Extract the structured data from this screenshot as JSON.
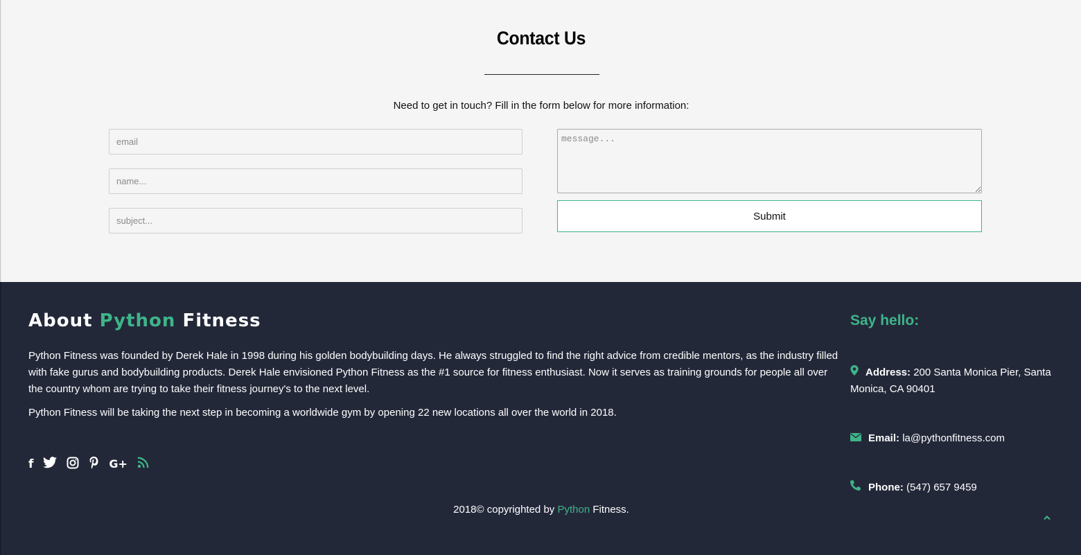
{
  "contact": {
    "title": "Contact Us",
    "intro": "Need to get in touch? Fill in the form below for more information:",
    "email_placeholder": "email",
    "name_placeholder": "name...",
    "subject_placeholder": "subject...",
    "message_placeholder": "message...",
    "submit_label": "Submit"
  },
  "footer": {
    "about_title": {
      "part1": "About ",
      "part2": "Python",
      "part3": " Fitness"
    },
    "about_paragraph_1": "Python Fitness was founded by Derek Hale in 1998 during his golden bodybuilding days. He always struggled to find the right advice from credible mentors, as the industry filled with fake gurus and bodybuilding products. Derek Hale envisioned Python Fitness as the #1 source for fitness enthusiast. Now it serves as training grounds for people all over the country whom are trying to take their fitness journey's to the next level.",
    "about_paragraph_2": "Python Fitness will be taking the next step in becoming a worldwide gym by opening 22 new locations all over the world in 2018.",
    "socials": [
      {
        "name": "facebook-icon",
        "glyph": "f"
      },
      {
        "name": "twitter-icon",
        "glyph": "🐦"
      },
      {
        "name": "instagram-icon",
        "glyph": "◎"
      },
      {
        "name": "pinterest-icon",
        "glyph": "℗"
      },
      {
        "name": "google-plus-icon",
        "glyph": "G+"
      },
      {
        "name": "rss-icon",
        "glyph": "⌇"
      }
    ],
    "say_hello": "Say hello:",
    "address_label": "Address:",
    "address_value": "200 Santa Monica Pier, Santa Monica, CA 90401",
    "email_label": "Email:",
    "email_value": "la@pythonfitness.com",
    "phone_label": "Phone:",
    "phone_value": "(547) 657 9459",
    "copyright": {
      "prefix": "2018© copyrighted by ",
      "brand": "Python",
      "suffix": " Fitness."
    },
    "to_top_icon": "⌃"
  },
  "colors": {
    "accent": "#3eb489",
    "footer_bg": "#232839",
    "page_bg": "#f5f5f5"
  }
}
